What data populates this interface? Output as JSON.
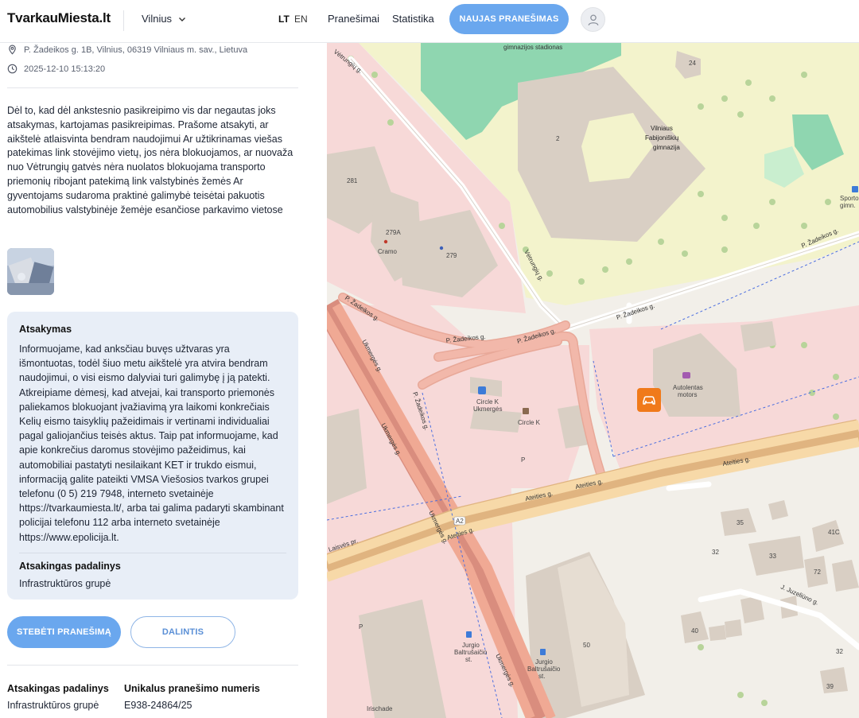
{
  "header": {
    "logo": "TvarkauMiesta.lt",
    "city": "Vilnius",
    "lang_lt": "LT",
    "lang_en": "EN",
    "nav_reports": "Pranešimai",
    "nav_stats": "Statistika",
    "new_report_button": "NAUJAS PRANEŠIMAS"
  },
  "report": {
    "address": "P. Žadeikos g. 1B, Vilnius, 06319 Vilniaus m. sav., Lietuva",
    "datetime": "2025-12-10 15:13:20",
    "description": "Dėl to, kad dėl ankstesnio pasikreipimo vis dar negautas joks atsakymas, kartojamas pasikreipimas. Prašome atsakyti, ar aikštelė atlaisvinta bendram naudojimui Ar užtikrinamas viešas patekimas link stovėjimo vietų, jos nėra blokuojamos, ar nuovaža nuo Vėtrungių gatvės nėra nuolatos blokuojama transporto priemonių ribojant patekimą link valstybinės žemės Ar gyventojams sudaroma praktinė galimybė teisėtai pakuotis automobilius valstybinėje žemėje esančiose parkavimo vietose"
  },
  "answer": {
    "title": "Atsakymas",
    "text": "Informuojame, kad anksčiau buvęs užtvaras yra išmontuotas, todėl šiuo metu aikštelė yra atvira bendram naudojimui, o visi eismo dalyviai turi galimybę į ją patekti. Atkreipiame dėmesį, kad atvejai, kai transporto priemonės paliekamos blokuojant įvažiavimą yra laikomi konkrečiais Kelių eismo taisyklių pažeidimais ir vertinami individualiai pagal galiojančius teisės aktus. Taip pat informuojame, kad apie konkrečius daromus stovėjimo pažeidimus, kai automobiliai pastatyti nesilaikant KET ir trukdo eismui, informaciją galite pateikti VMSA Viešosios tvarkos grupei telefonu (0 5) 219 7948, interneto svetainėje https://tvarkaumiesta.lt/, arba tai galima padaryti skambinant policijai telefonu 112 arba interneto svetainėje https://www.epolicija.lt.",
    "unit_label": "Atsakingas padalinys",
    "unit_value": "Infrastruktūros grupė"
  },
  "actions": {
    "follow_button": "STEBĖTI PRANEŠIMĄ",
    "share_button": "DALINTIS"
  },
  "footer": {
    "unit_label": "Atsakingas padalinys",
    "unit_value": "Infrastruktūros grupė",
    "id_label": "Unikalus pranešimo numeris",
    "id_value": "E938-24864/25"
  },
  "map": {
    "labels": {
      "stadium": "gimnazijos stadionas",
      "school_1": "Vilniaus",
      "school_2": "Fabijoniškių",
      "school_3": "gimnazija",
      "vetrungiu_1": "Vėtrungių g.",
      "vetrungiu_2": "Vėtrungių g.",
      "zadeikos_1": "P. Žadeikos g.",
      "zadeikos_2": "P. Žadeikos g.",
      "zadeikos_3": "P. Žadeikos g.",
      "zadeikos_4": "P. Žadeikos g.",
      "zadeikos_5": "P. Žadeikos g.",
      "ukmerges_1": "Ukmergės g.",
      "ukmerges_2": "Ukmergės g.",
      "ukmerges_3": "Ukmergės g.",
      "ukmerges_4": "Ukmergės g.",
      "ateities_1": "Ateities g.",
      "ateities_2": "Ateities g.",
      "ateities_3": "Ateities g.",
      "laisves": "Laisvės pr.",
      "juzeliuno": "J. Juzeliūno g.",
      "circle_k_1": "Circle K",
      "circle_k_1b": "Ukmergės",
      "circle_k_2": "Circle K",
      "autolentas_1": "Autolentas",
      "autolentas_2": "motors",
      "cramo": "Cramo",
      "stop_1a": "Jurgio",
      "stop_1b": "Baltrušaičio",
      "stop_1c": "st.",
      "stop_2a": "Jurgio",
      "stop_2b": "Baltrušaičio",
      "stop_2c": "st.",
      "sport_1": "Sporto",
      "sport_2": "gimn.",
      "a2": "A2",
      "parking": "P",
      "n_24": "24",
      "n_2": "2",
      "n_281": "281",
      "n_279a": "279A",
      "n_279": "279",
      "n_35": "35",
      "n_33": "33",
      "n_32": "32",
      "n_41c": "41C",
      "n_72": "72",
      "n_40": "40",
      "n_50": "50",
      "n_32b": "32",
      "n_39": "39",
      "irischade": "Irischade"
    }
  }
}
